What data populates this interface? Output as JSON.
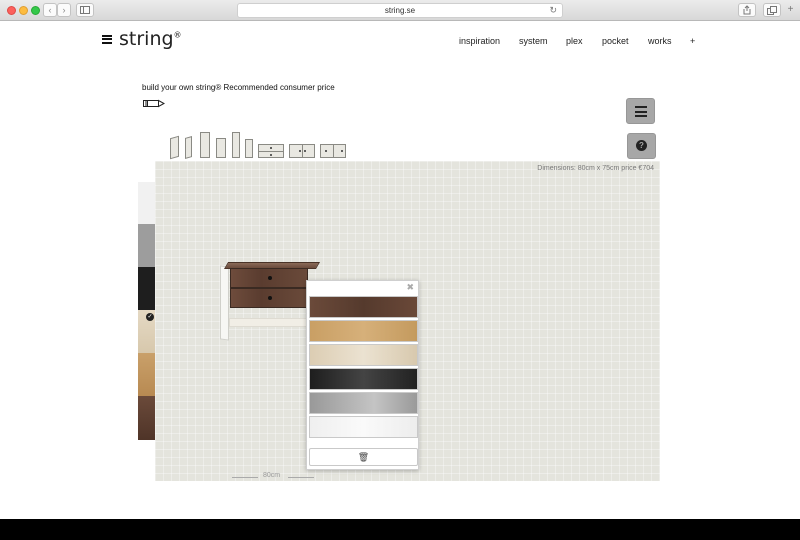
{
  "browser": {
    "url": "string.se",
    "back_glyph": "‹",
    "forward_glyph": "›",
    "reload_glyph": "↻",
    "newtab_glyph": "+"
  },
  "header": {
    "logo": "string",
    "logo_mark": "®",
    "nav": [
      "inspiration",
      "system",
      "plex",
      "pocket",
      "works",
      "+"
    ]
  },
  "builder": {
    "title": "build your own string®   Recommended consumer price",
    "help_glyph": "?",
    "dimensions": "Dimensions: 80cm x 75cm   price €704",
    "width_label": "80cm",
    "close_glyph": "✖",
    "trash_glyph": "🗑",
    "colors": {
      "walnut": "#5e4234",
      "oak": "#c89e62",
      "ash": "#d9cbb3",
      "black": "#2a2a2a",
      "grey": "#a9a9a9",
      "white": "#f2f2f2"
    }
  }
}
